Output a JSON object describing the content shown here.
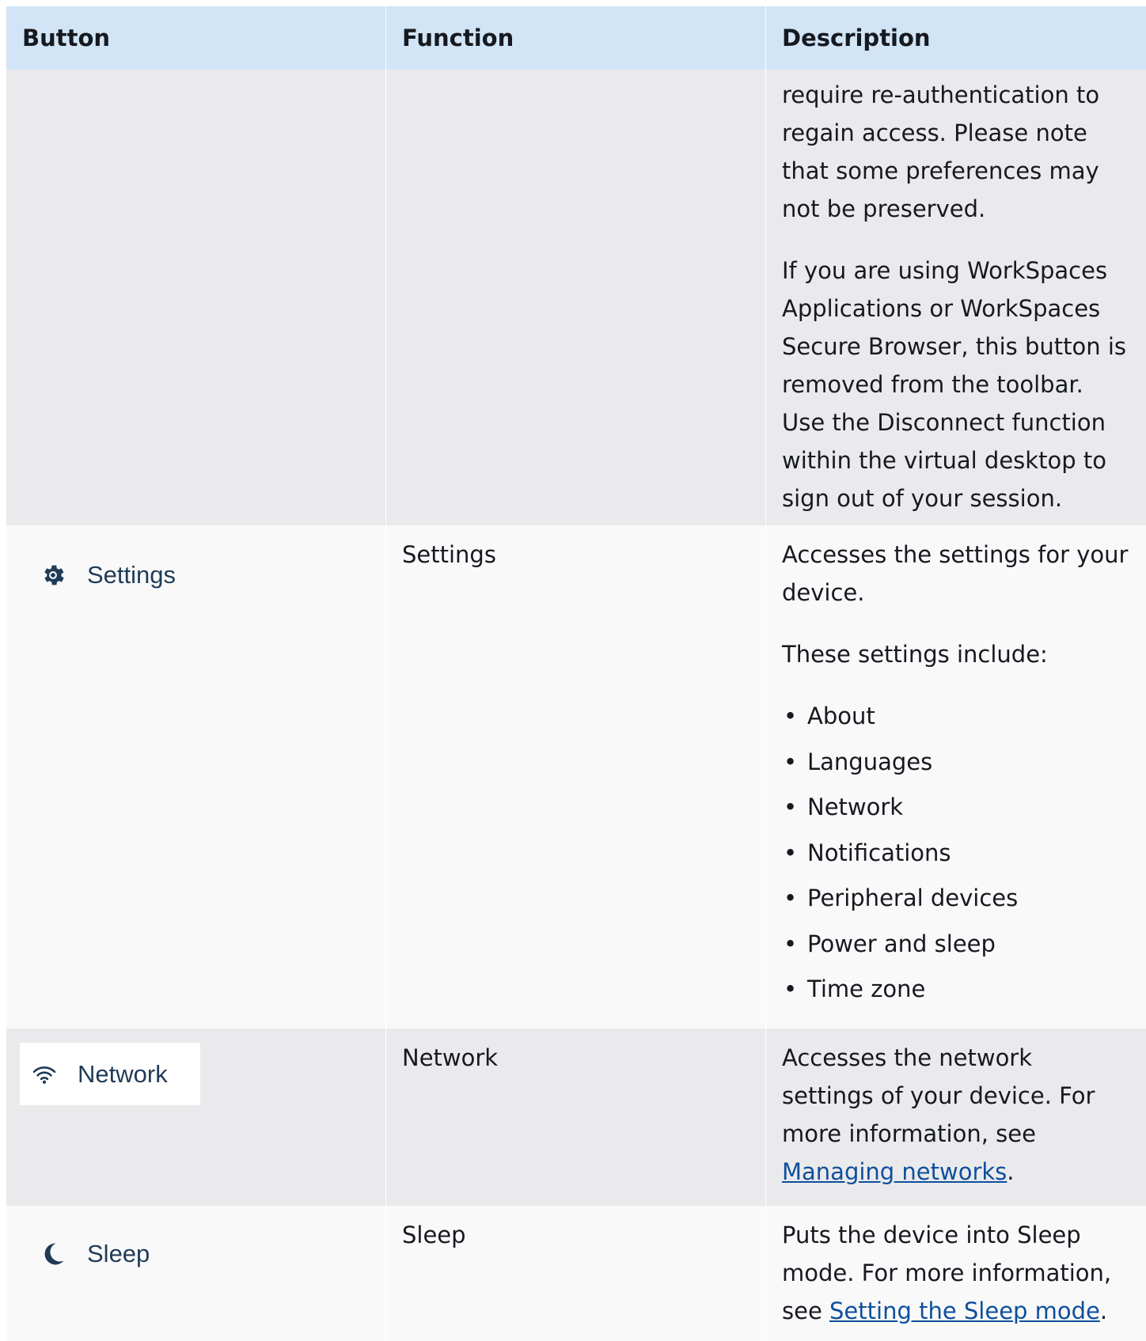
{
  "table": {
    "headers": [
      "Button",
      "Function",
      "Description"
    ],
    "rows": [
      {
        "description_paragraphs": [
          "require re-authentication to regain access. Please note that some preferences may not be preserved.",
          "If you are using WorkSpaces Applications or WorkSpaces Secure Browser, this button is removed from the toolbar. Use the Disconnect function within the virtual desktop to sign out of your session."
        ]
      },
      {
        "button": {
          "label": "Settings",
          "icon": "gear-icon"
        },
        "function": "Settings",
        "description": "Accesses the settings for your device.",
        "intro": "These settings include:",
        "items": [
          "About",
          "Languages",
          "Network",
          "Notifications",
          "Peripheral devices",
          "Power and sleep",
          "Time zone"
        ]
      },
      {
        "button": {
          "label": "Network",
          "icon": "wifi-icon"
        },
        "function": "Network",
        "description_prefix": "Accesses the network settings of your device. For more information, see ",
        "link": "Managing networks",
        "description_suffix": "."
      },
      {
        "button": {
          "label": "Sleep",
          "icon": "moon-icon"
        },
        "function": "Sleep",
        "description_prefix": "Puts the device into Sleep mode. For more information, see ",
        "link": "Setting the Sleep mode",
        "description_suffix": "."
      }
    ]
  },
  "colors": {
    "header_bg": "#d1e5f6",
    "row_shaded": "#eaeaed",
    "row_light": "#f9f9fa",
    "link": "#0e4f9c",
    "icon": "#1f3b57"
  }
}
